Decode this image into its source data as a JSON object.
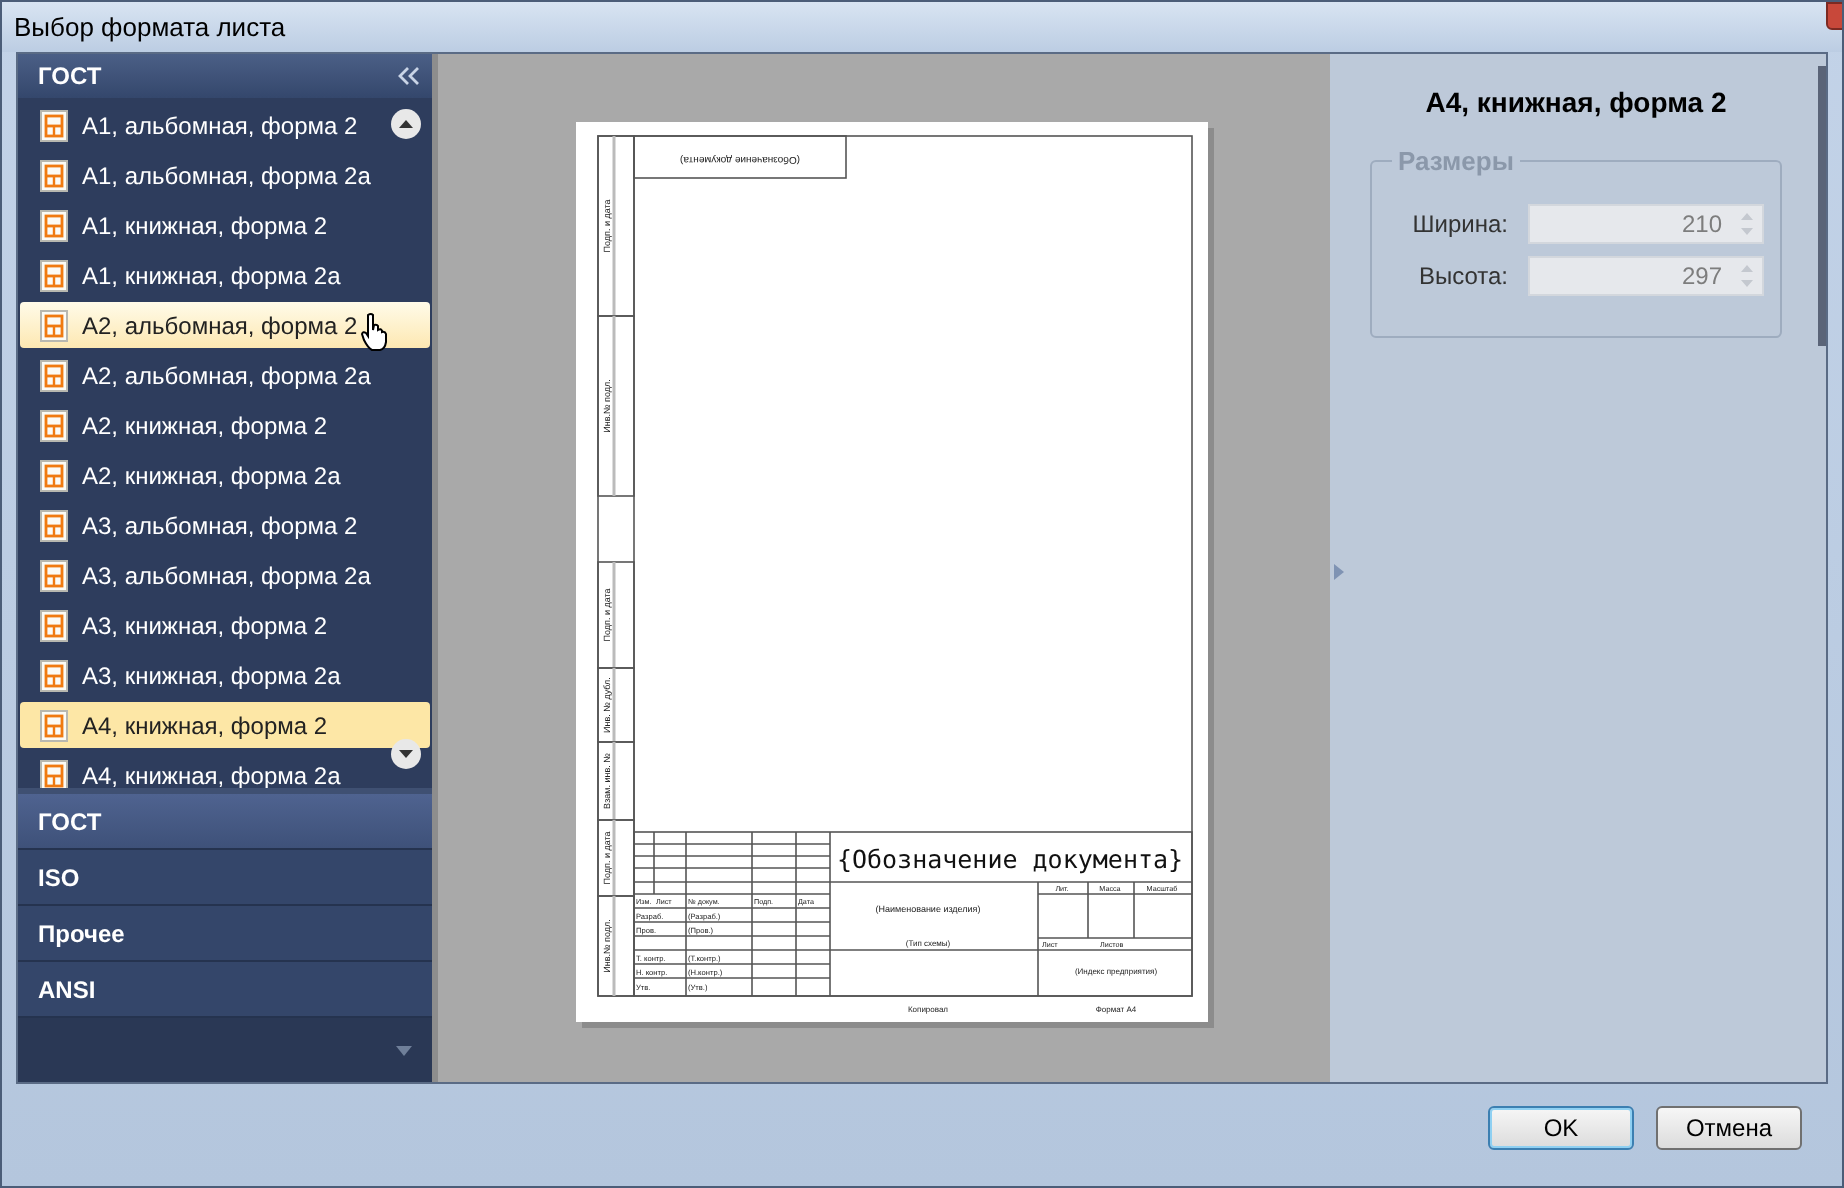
{
  "window": {
    "title": "Выбор формата листа"
  },
  "sidebar": {
    "header": "ГОСТ",
    "items": [
      {
        "label": "A1, альбомная, форма 2",
        "selected": false,
        "hovered": false
      },
      {
        "label": "A1, альбомная, форма 2а",
        "selected": false,
        "hovered": false
      },
      {
        "label": "A1, книжная, форма 2",
        "selected": false,
        "hovered": false
      },
      {
        "label": "A1, книжная, форма 2а",
        "selected": false,
        "hovered": false
      },
      {
        "label": "A2, альбомная, форма 2",
        "selected": false,
        "hovered": true
      },
      {
        "label": "A2, альбомная, форма 2а",
        "selected": false,
        "hovered": false
      },
      {
        "label": "A2, книжная, форма 2",
        "selected": false,
        "hovered": false
      },
      {
        "label": "A2, книжная, форма 2а",
        "selected": false,
        "hovered": false
      },
      {
        "label": "A3, альбомная, форма 2",
        "selected": false,
        "hovered": false
      },
      {
        "label": "A3, альбомная, форма 2а",
        "selected": false,
        "hovered": false
      },
      {
        "label": "A3, книжная, форма 2",
        "selected": false,
        "hovered": false
      },
      {
        "label": "A3, книжная, форма 2а",
        "selected": false,
        "hovered": false
      },
      {
        "label": "A4, книжная, форма 2",
        "selected": true,
        "hovered": false
      },
      {
        "label": "A4, книжная, форма 2а",
        "selected": false,
        "hovered": false
      }
    ],
    "groups": [
      {
        "label": "ГОСТ",
        "selected": true
      },
      {
        "label": "ISO",
        "selected": false
      },
      {
        "label": "Прочее",
        "selected": false
      },
      {
        "label": "ANSI",
        "selected": false
      }
    ]
  },
  "sheet": {
    "title": "{Обозначение документа}",
    "top_box": "(Обозначение документа)",
    "side_labels": [
      "Подп. и дата",
      "Инв.№ подл.",
      "Подп. и дата",
      "Инв. № дубл.",
      "Взам. инв. №",
      "Подп. и дата",
      "Инв.№ подл."
    ],
    "block_headers": [
      "Изм.",
      "Лист",
      "№ докум.",
      "Подп.",
      "Дата"
    ],
    "roles": [
      {
        "role": "Разраб.",
        "value": "(Разраб.)"
      },
      {
        "role": "Пров.",
        "value": "(Пров.)"
      },
      {
        "role": "Т. контр.",
        "value": "(Т.контр.)"
      },
      {
        "role": "Н. контр.",
        "value": "(Н.контр.)"
      },
      {
        "role": "Утв.",
        "value": "(Утв.)"
      }
    ],
    "name": "(Наименование изделия)",
    "scheme": "(Тип схемы)",
    "lit_headers": [
      "Лит.",
      "Масса",
      "Масштаб"
    ],
    "sheet_row": [
      "Лист",
      "Листов"
    ],
    "index": "(Индекс предприятия)",
    "copied": "Копировал",
    "format": "Формат А4"
  },
  "details": {
    "title": "A4, книжная, форма 2",
    "group": "Размеры",
    "disabled": true,
    "fields": [
      {
        "label": "Ширина:",
        "value": "210"
      },
      {
        "label": "Высота:",
        "value": "297"
      }
    ]
  },
  "buttons": [
    {
      "label": "OK",
      "default": true
    },
    {
      "label": "Отмена",
      "default": false
    }
  ]
}
